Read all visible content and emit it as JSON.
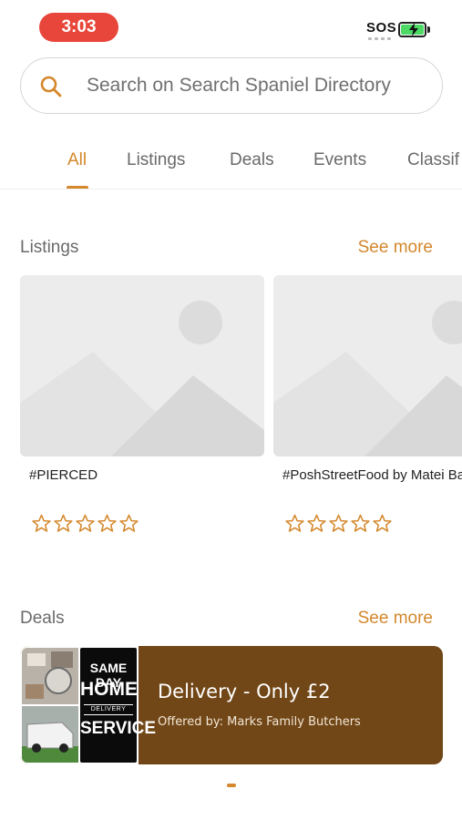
{
  "status_bar": {
    "time": "3:03",
    "sos_label": "SOS",
    "battery_icon": "battery-charging-icon"
  },
  "search": {
    "placeholder": "Search on Search Spaniel Directory",
    "value": ""
  },
  "tabs": [
    {
      "label": "All",
      "active": true
    },
    {
      "label": "Listings",
      "active": false
    },
    {
      "label": "Deals",
      "active": false
    },
    {
      "label": "Events",
      "active": false
    },
    {
      "label": "Classif",
      "active": false
    }
  ],
  "listings_section": {
    "title": "Listings",
    "see_more": "See more",
    "items": [
      {
        "name": "#PIERCED",
        "rating": 0,
        "max_rating": 5
      },
      {
        "name": "#PoshStreetFood by Matei Baran",
        "rating": 0,
        "max_rating": 5
      }
    ]
  },
  "deals_section": {
    "title": "Deals",
    "see_more": "See more",
    "items": [
      {
        "title": "Delivery - Only £2",
        "offered_by": "Offered by: Marks Family Butchers",
        "image_sign": {
          "line1": "SAME DAY",
          "line2": "HOME",
          "line3": "DELIVERY",
          "line4": "SERVICE"
        }
      }
    ]
  },
  "colors": {
    "accent": "#d4872b",
    "deal_background": "#724717",
    "time_pill": "#e8463a"
  }
}
